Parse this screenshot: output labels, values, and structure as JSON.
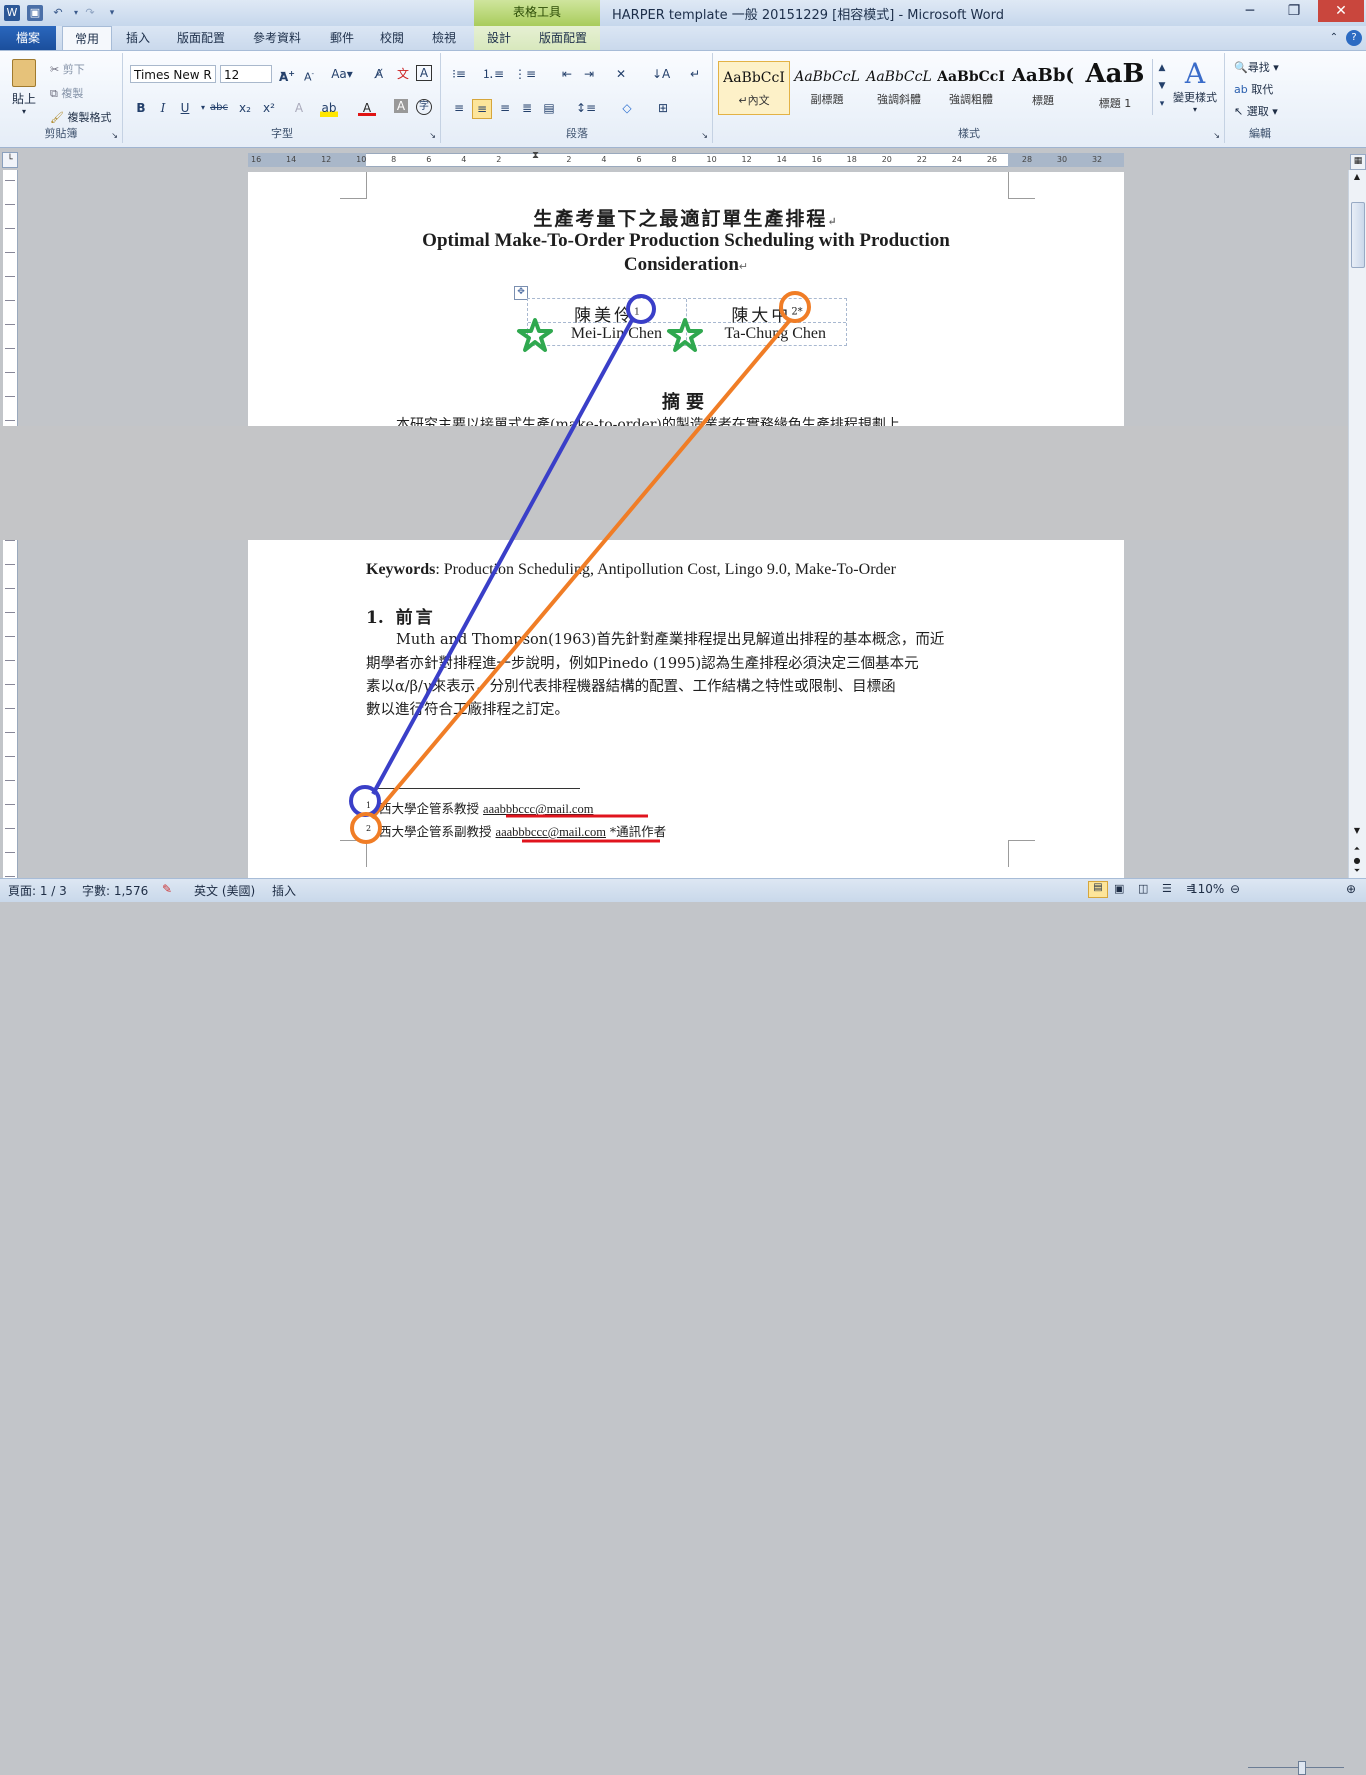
{
  "titlebar": {
    "title": "HARPER template 一般 20151229 [相容模式] - Microsoft Word",
    "context_tab_group": "表格工具",
    "minimize": "─",
    "restore": "❐",
    "close": "✕"
  },
  "tabs": {
    "file": "檔案",
    "home": "常用",
    "insert": "插入",
    "layout": "版面配置",
    "references": "參考資料",
    "mailings": "郵件",
    "review": "校閱",
    "view": "檢視",
    "design": "設計",
    "table_layout": "版面配置"
  },
  "ribbon": {
    "clipboard": {
      "paste": "貼上",
      "cut": "剪下",
      "copy": "複製",
      "format_painter": "複製格式",
      "label": "剪貼簿"
    },
    "font": {
      "font_name": "Times New R",
      "font_size": "12",
      "label": "字型",
      "bold": "B",
      "italic": "I",
      "underline": "U",
      "strike": "abc",
      "sub": "x₂",
      "sup": "x²",
      "grow": "A",
      "shrink": "A",
      "aa": "Aa",
      "clear": "A"
    },
    "paragraph": {
      "label": "段落"
    },
    "styles": {
      "label": "樣式",
      "change_styles": "變更樣式",
      "items": [
        {
          "sample": "AaBbCcI",
          "name": "↵內文"
        },
        {
          "sample": "AaBbCcL",
          "name": "副標題"
        },
        {
          "sample": "AaBbCcL",
          "name": "強調斜體"
        },
        {
          "sample": "AaBbCcI",
          "name": "強調粗體"
        },
        {
          "sample": "AaBb(",
          "name": "標題"
        },
        {
          "sample": "AaB",
          "name": "標題 1"
        }
      ]
    },
    "editing": {
      "label": "編輯",
      "find": "尋找",
      "replace": "取代",
      "select": "選取"
    }
  },
  "ruler": {
    "ticks": [
      "16",
      "14",
      "12",
      "10",
      "8",
      "6",
      "4",
      "2",
      "",
      "2",
      "4",
      "6",
      "8",
      "10",
      "12",
      "14",
      "16",
      "18",
      "20",
      "22",
      "24",
      "26",
      "28",
      "30",
      "32"
    ]
  },
  "document": {
    "title_zh": "生產考量下之最適訂單生產排程",
    "title_en_1": "Optimal Make-To-Order Production Scheduling with Production",
    "title_en_2": "Consideration",
    "author1_zh": "陳美伶",
    "author1_en": "Mei-Lin Chen",
    "author1_sup": "1",
    "author2_zh": "陳大中",
    "author2_en": "Ta-Chung Chen",
    "author2_sup": "2*",
    "abstract_heading": "摘要",
    "abstract_line": "本研究主要以接單式生產(make-to-order)的製造業者在實務緣色生產排程規劃上",
    "keywords_label": "Keywords",
    "keywords_text": ": Production Scheduling, Antipollution Cost, Lingo 9.0, Make-To-Order",
    "section_number": "1.",
    "section_title": "前言",
    "body_lines": [
      "Muth and Thompson(1963)首先針對產業排程提出見解道出排程的基本概念，而近",
      "期學者亦針對排程進一步說明，例如Pinedo (1995)認為生產排程必須決定三個基本元",
      "素以α/β/γ來表示，分別代表排程機器結構的配置、工作結構之特性或限制、目標函",
      "數以進行符合工廠排程之訂定。"
    ],
    "footnote1_num": "1",
    "footnote1_text": "西大學企管系教授 ",
    "footnote1_email": "aaabbbccc@mail.com",
    "footnote2_num": "2",
    "footnote2_text": "西大學企管系副教授 ",
    "footnote2_email": "aaabbbccc@mail.com",
    "footnote2_tail": " *通訊作者"
  },
  "statusbar": {
    "page": "頁面: 1 / 3",
    "words": "字數: 1,576",
    "language": "英文 (美國)",
    "mode": "插入",
    "zoom": "110%",
    "zoom_fraction": 0.55
  },
  "colors": {
    "blue_annotation": "#3a3fc8",
    "orange_annotation": "#f07d26",
    "green_star": "#2fa84f",
    "red_underline": "#e0141e"
  }
}
